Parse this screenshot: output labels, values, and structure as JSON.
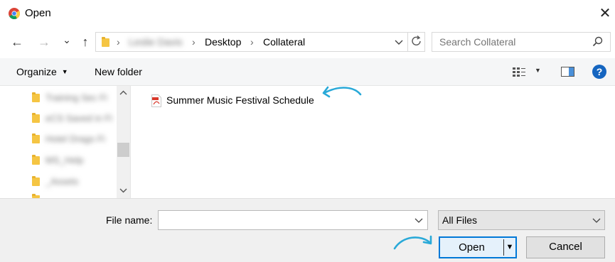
{
  "window": {
    "title": "Open",
    "icons": {
      "app": "chrome-icon",
      "close": "close-icon"
    }
  },
  "nav": {
    "back": "←",
    "forward": "→",
    "dropdown": "⌄",
    "up": "↑"
  },
  "address": {
    "crumbs": [
      "Leslie Davis",
      "Desktop",
      "Collateral"
    ],
    "separator": "›"
  },
  "search": {
    "placeholder": "Search Collateral"
  },
  "toolbar": {
    "organize_label": "Organize",
    "new_folder_label": "New folder",
    "help_label": "?"
  },
  "tree": {
    "items": [
      "Training Sec Fi",
      "eCS Saved in Fi",
      "Hotel Drago Fi",
      "MS_Help",
      "_Assets"
    ]
  },
  "files": [
    {
      "name": "Summer Music Festival Schedule",
      "type": "pdf-icon"
    }
  ],
  "bottom": {
    "file_name_label": "File name:",
    "file_name_value": "",
    "file_type_value": "All Files",
    "open_label": "Open",
    "cancel_label": "Cancel"
  },
  "colors": {
    "accent": "#0078d7",
    "annotation": "#29a9d8",
    "folder": "#f5c543"
  }
}
